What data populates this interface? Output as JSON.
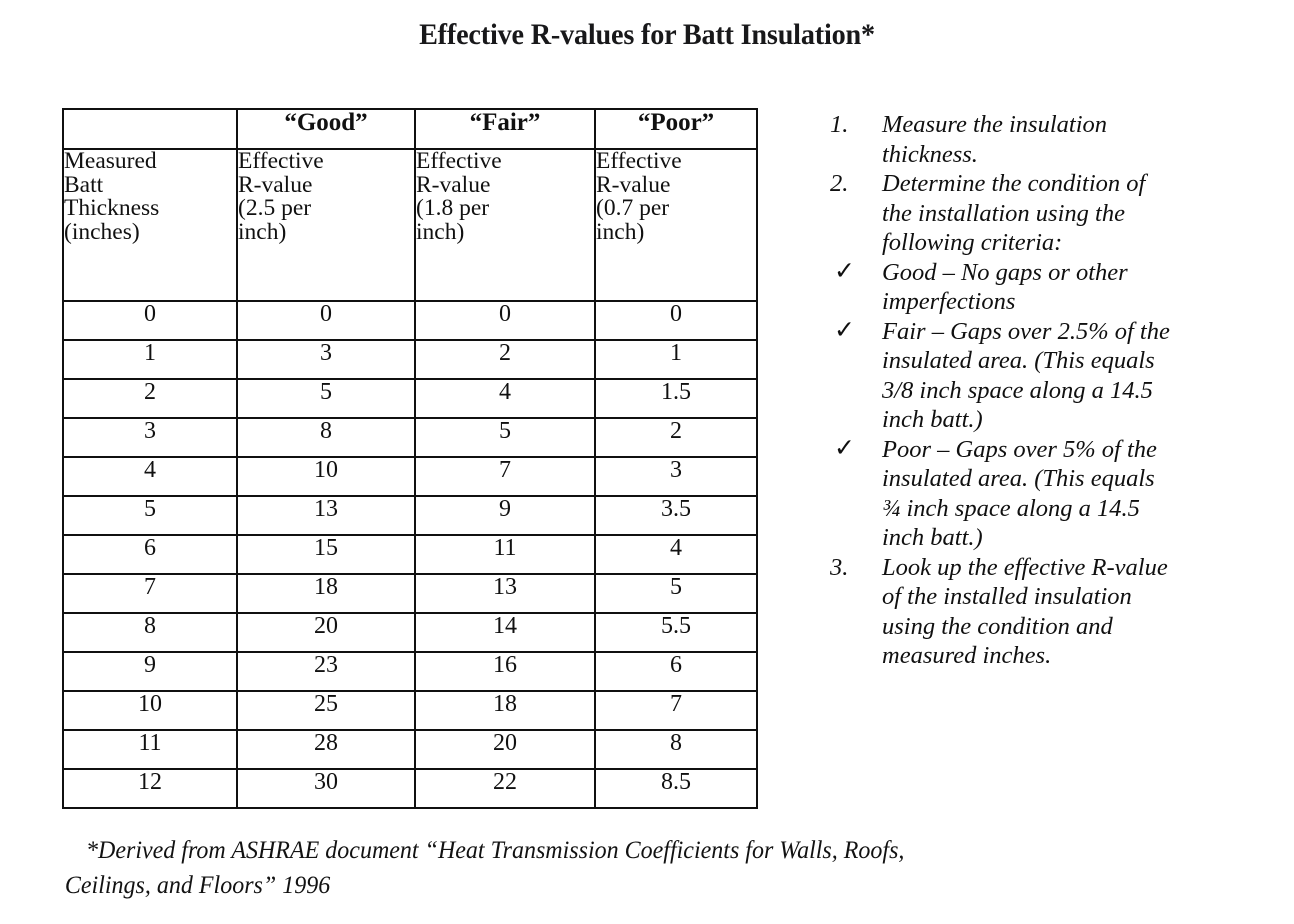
{
  "document": {
    "title": "Effective R-values for Batt Insulation*"
  },
  "table": {
    "corner_blank": "",
    "quality_headers": [
      "“Good”",
      "“Fair”",
      "“Poor”"
    ],
    "descriptions": [
      {
        "l1": "Measured",
        "l2": "Batt",
        "l3": "Thickness",
        "l4": "(inches)"
      },
      {
        "l1": "Effective",
        "l2": "R-value",
        "l3": "(2.5 per",
        "l4": "inch)"
      },
      {
        "l1": "Effective",
        "l2": "R-value",
        "l3": "(1.8 per",
        "l4": "inch)"
      },
      {
        "l1": "Effective",
        "l2": "R-value",
        "l3": "(0.7 per",
        "l4": "inch)"
      }
    ],
    "rows": [
      {
        "thickness": "0",
        "good": "0",
        "fair": "0",
        "poor": "0"
      },
      {
        "thickness": "1",
        "good": "3",
        "fair": "2",
        "poor": "1"
      },
      {
        "thickness": "2",
        "good": "5",
        "fair": "4",
        "poor": "1.5"
      },
      {
        "thickness": "3",
        "good": "8",
        "fair": "5",
        "poor": "2"
      },
      {
        "thickness": "4",
        "good": "10",
        "fair": "7",
        "poor": "3"
      },
      {
        "thickness": "5",
        "good": "13",
        "fair": "9",
        "poor": "3.5"
      },
      {
        "thickness": "6",
        "good": "15",
        "fair": "11",
        "poor": "4"
      },
      {
        "thickness": "7",
        "good": "18",
        "fair": "13",
        "poor": "5"
      },
      {
        "thickness": "8",
        "good": "20",
        "fair": "14",
        "poor": "5.5"
      },
      {
        "thickness": "9",
        "good": "23",
        "fair": "16",
        "poor": "6"
      },
      {
        "thickness": "10",
        "good": "25",
        "fair": "18",
        "poor": "7"
      },
      {
        "thickness": "11",
        "good": "28",
        "fair": "20",
        "poor": "8"
      },
      {
        "thickness": "12",
        "good": "30",
        "fair": "22",
        "poor": "8.5"
      }
    ]
  },
  "instructions": {
    "step1": {
      "marker": "1.",
      "line1": "Measure the insulation",
      "line2": "thickness."
    },
    "step2": {
      "marker": "2.",
      "line1": "Determine the condition of",
      "line2": "the installation using the",
      "line3": "following criteria:"
    },
    "criteria": [
      {
        "marker": "✓",
        "term": "Good",
        "line1_rest": " – No gaps or other",
        "line2": "imperfections",
        "line3": "",
        "line4": ""
      },
      {
        "marker": "✓",
        "term": "Fair",
        "line1_rest": " – Gaps over 2.5% of the",
        "line2": "insulated area.  (This equals",
        "line3": "3/8  inch space along a 14.5",
        "line4": "inch batt.)"
      },
      {
        "marker": "✓",
        "term": "Poor",
        "line1_rest": " – Gaps over 5% of the",
        "line2": "insulated area.  (This equals",
        "line3": "¾ inch space along a 14.5",
        "line4": "inch batt.)"
      }
    ],
    "step3": {
      "marker": "3.",
      "line1": "Look up the effective R-value",
      "line2": "of the installed insulation",
      "line3": "using the condition and",
      "line4": "measured inches."
    }
  },
  "footnote": {
    "line1": "*Derived from ASHRAE document “Heat Transmission Coefficients for Walls, Roofs,",
    "line2": "Ceilings, and Floors” 1996"
  },
  "colors": {
    "header_fill": "#ededed",
    "highlight_yellow": "#f8f2c2",
    "rule": "#101010",
    "text": "#111111"
  }
}
